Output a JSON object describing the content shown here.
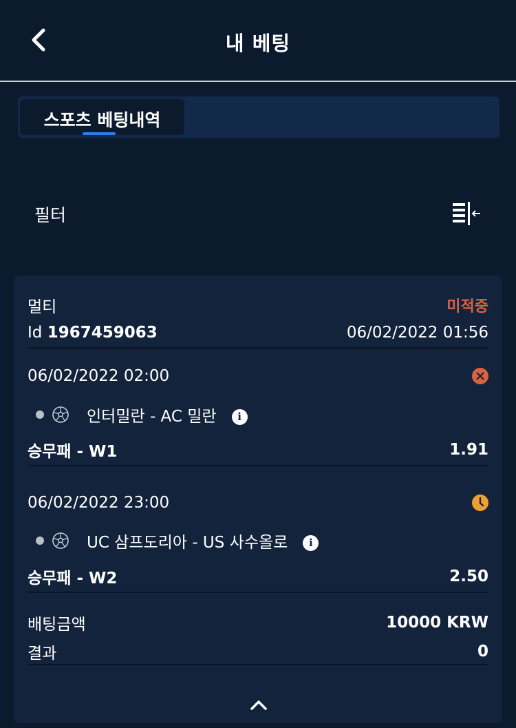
{
  "header": {
    "title": "내 베팅",
    "back_icon": "chevron-left-icon"
  },
  "tabs": [
    {
      "label": "스포츠 베팅내역",
      "active": true
    }
  ],
  "filter": {
    "label": "필터",
    "icon": "filter-collapse-icon"
  },
  "bet": {
    "type": "멀티",
    "status": "미적중",
    "id_label": "Id",
    "id_value": "1967459063",
    "placed_at": "06/02/2022 01:56",
    "selections": [
      {
        "datetime": "06/02/2022 02:00",
        "result_icon": "lost-x-icon",
        "sport_icon": "soccer-ball-icon",
        "event": "인터밀란 - AC 밀란",
        "market": "승무패 - W1",
        "odds": "1.91"
      },
      {
        "datetime": "06/02/2022 23:00",
        "result_icon": "pending-clock-icon",
        "sport_icon": "soccer-ball-icon",
        "event": "UC 삼프도리아 - US 사수올로",
        "market": "승무패 - W2",
        "odds": "2.50"
      }
    ],
    "stake_label": "배팅금액",
    "stake_value": "10000 KRW",
    "result_label": "결과",
    "result_value": "0"
  },
  "colors": {
    "background": "#0c1a2d",
    "card": "#12233b",
    "accent": "#2e7df0",
    "lost": "#d9633f",
    "pending": "#f0a030"
  }
}
